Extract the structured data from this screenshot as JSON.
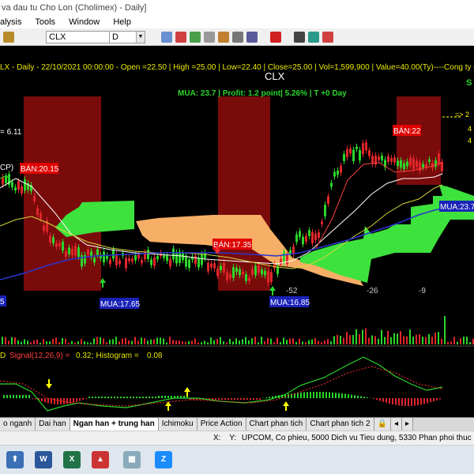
{
  "window": {
    "title": "va dau tu Cho Lon (Cholimex) - Daily]"
  },
  "menu": [
    "alysis",
    "Tools",
    "Window",
    "Help"
  ],
  "toolbar": {
    "symbol": "CLX",
    "period": "D"
  },
  "info_line": "LX - Daily - 22/10/2021 00:00:00 -  Open =22.50 | High =25.00 | Low=22.40 | Close=25.00 | Vol=1,599,900 | Value=40.00(Ty)----Cong ty co pha",
  "chart_title": "CLX",
  "trade_summary": "MUA:  23.7  | Profit: 1.2 point| 5.26% | T +0 Day",
  "right_edge_labels": {
    "s": "S",
    "arrow": "=>  2",
    "v1": "4",
    "v2": "4"
  },
  "signals": {
    "left_value": "= 6.11",
    "cp": "CP)",
    "ban1": "BÁN:20.15",
    "ban2": "BÁN:17.35",
    "ban3": "BÁN:22",
    "mua1": "MUA:17.65",
    "mua2": "MUA:16.85",
    "mua3": "MUA:23.75",
    "left_edge": "5"
  },
  "bar_counts": [
    "-52",
    "-26",
    "-9"
  ],
  "macd_line": {
    "prefix": "D",
    "signal": "Signal(12,26,9) =",
    "signal_val": "0.32",
    "hist": "; Histogram =",
    "hist_val": "0.08"
  },
  "tabs": [
    "o nganh",
    "Dai han",
    "Ngan han + trung han",
    "Ichimoku",
    "Price Action",
    "Chart phan tich",
    "Chart phan tich 2"
  ],
  "active_tab": "Ngan han + trung han",
  "status": {
    "x": "X:",
    "y": "Y:",
    "text": "UPCOM, Co phieu, 5000 Dich vu Tieu dung, 5330 Phan phoi thuc pham d"
  },
  "taskbar_icons": [
    "app",
    "word-icon",
    "excel-icon",
    "amibroker-icon",
    "film-icon",
    "zalo-icon"
  ],
  "colors": {
    "bull": "#2bd62b",
    "bear": "#e0262a",
    "cloud_green": "#3de23d",
    "cloud_orange": "#f7ae66",
    "sell_zone": "#7a0b0b",
    "bg": "#000000",
    "label_ban": "#e00000",
    "label_mua": "#1a22b8"
  }
}
